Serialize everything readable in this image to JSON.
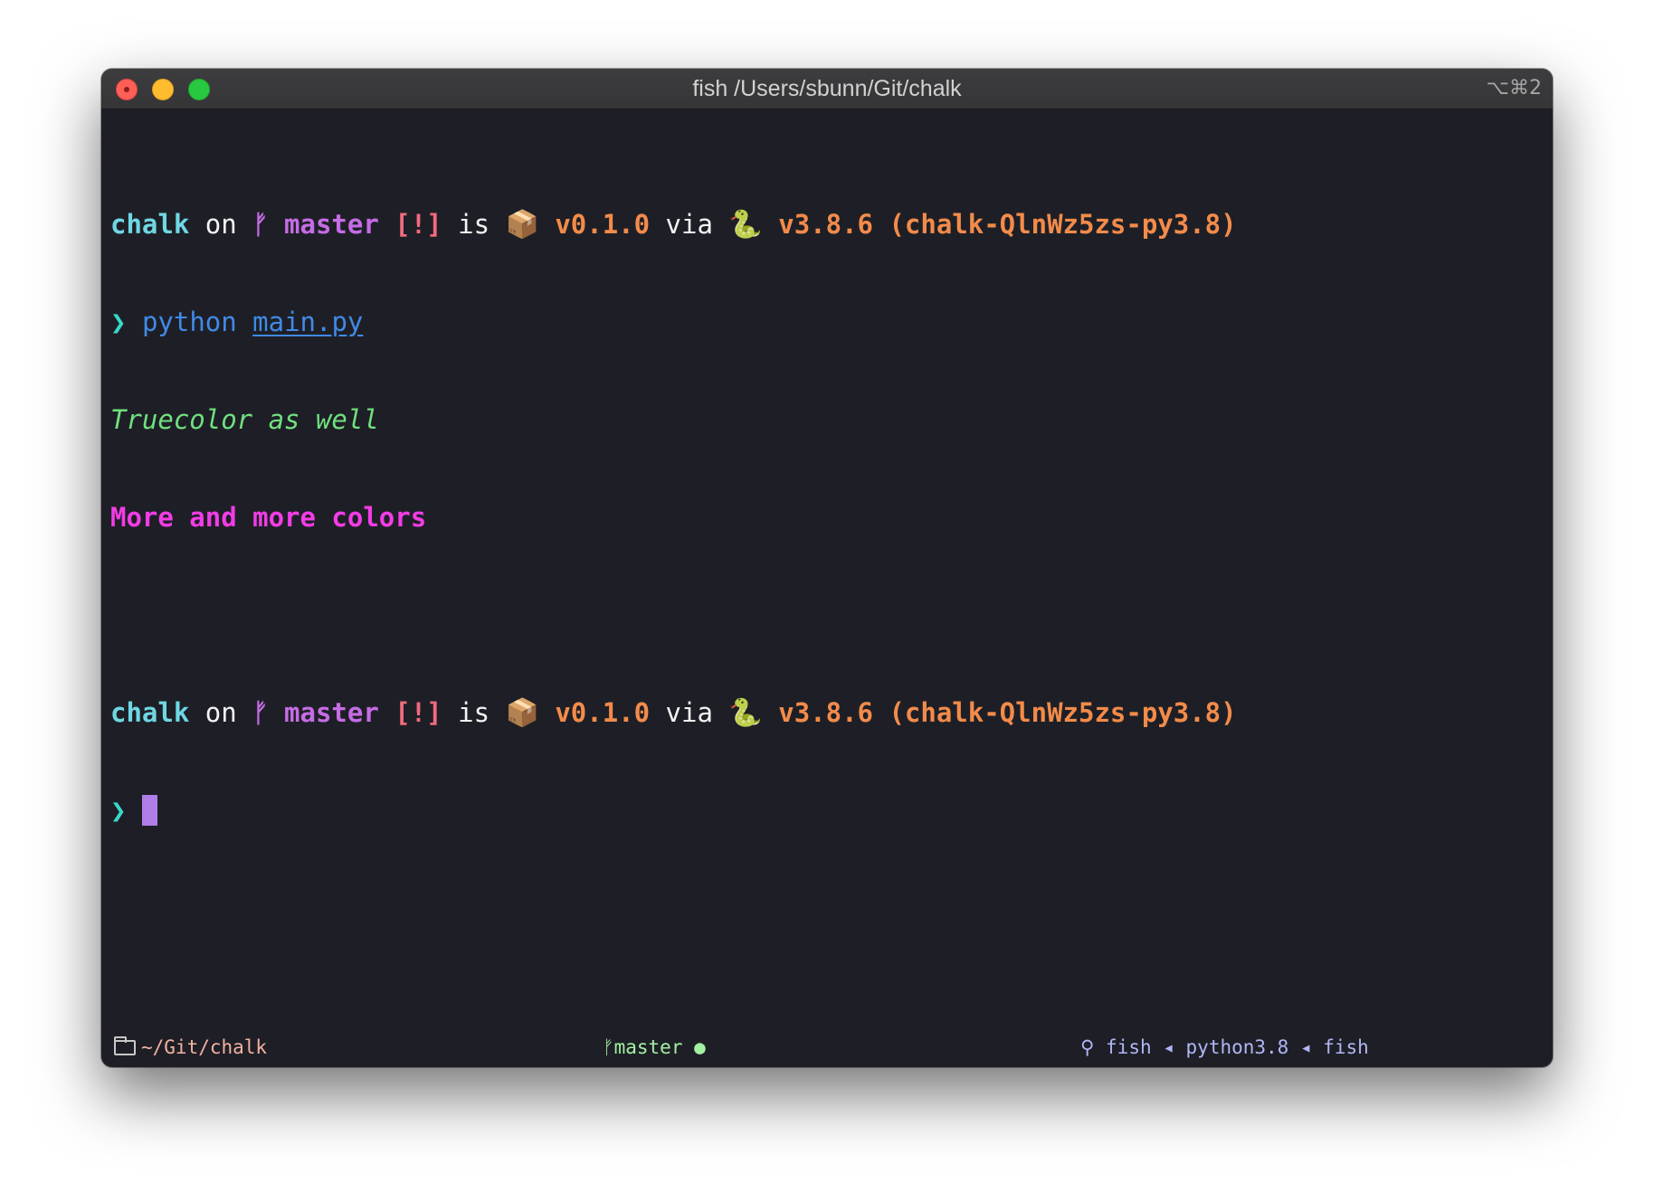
{
  "window": {
    "title": "fish /Users/sbunn/Git/chalk",
    "shortcut": "⌥⌘2"
  },
  "prompt": {
    "dir": "chalk",
    "on": " on ",
    "branch_icon": "",
    "branch": "master",
    "status": "[!]",
    "is": " is ",
    "package_emoji": "📦",
    "package_version": "v0.1.0",
    "via": " via ",
    "python_emoji": "🐍",
    "python_version": "v3.8.6",
    "venv": "(chalk-QlnWz5zs-py3.8)",
    "symbol": "❯"
  },
  "command": {
    "program": "python",
    "argument": "main.py"
  },
  "output": [
    "Truecolor as well",
    "More and more colors"
  ],
  "statusbar": {
    "path": "~/Git/chalk",
    "branch_icon": "",
    "branch": "master",
    "dirty": "●",
    "process_icon": "",
    "processes": "fish ◂ python3.8 ◂ fish"
  }
}
